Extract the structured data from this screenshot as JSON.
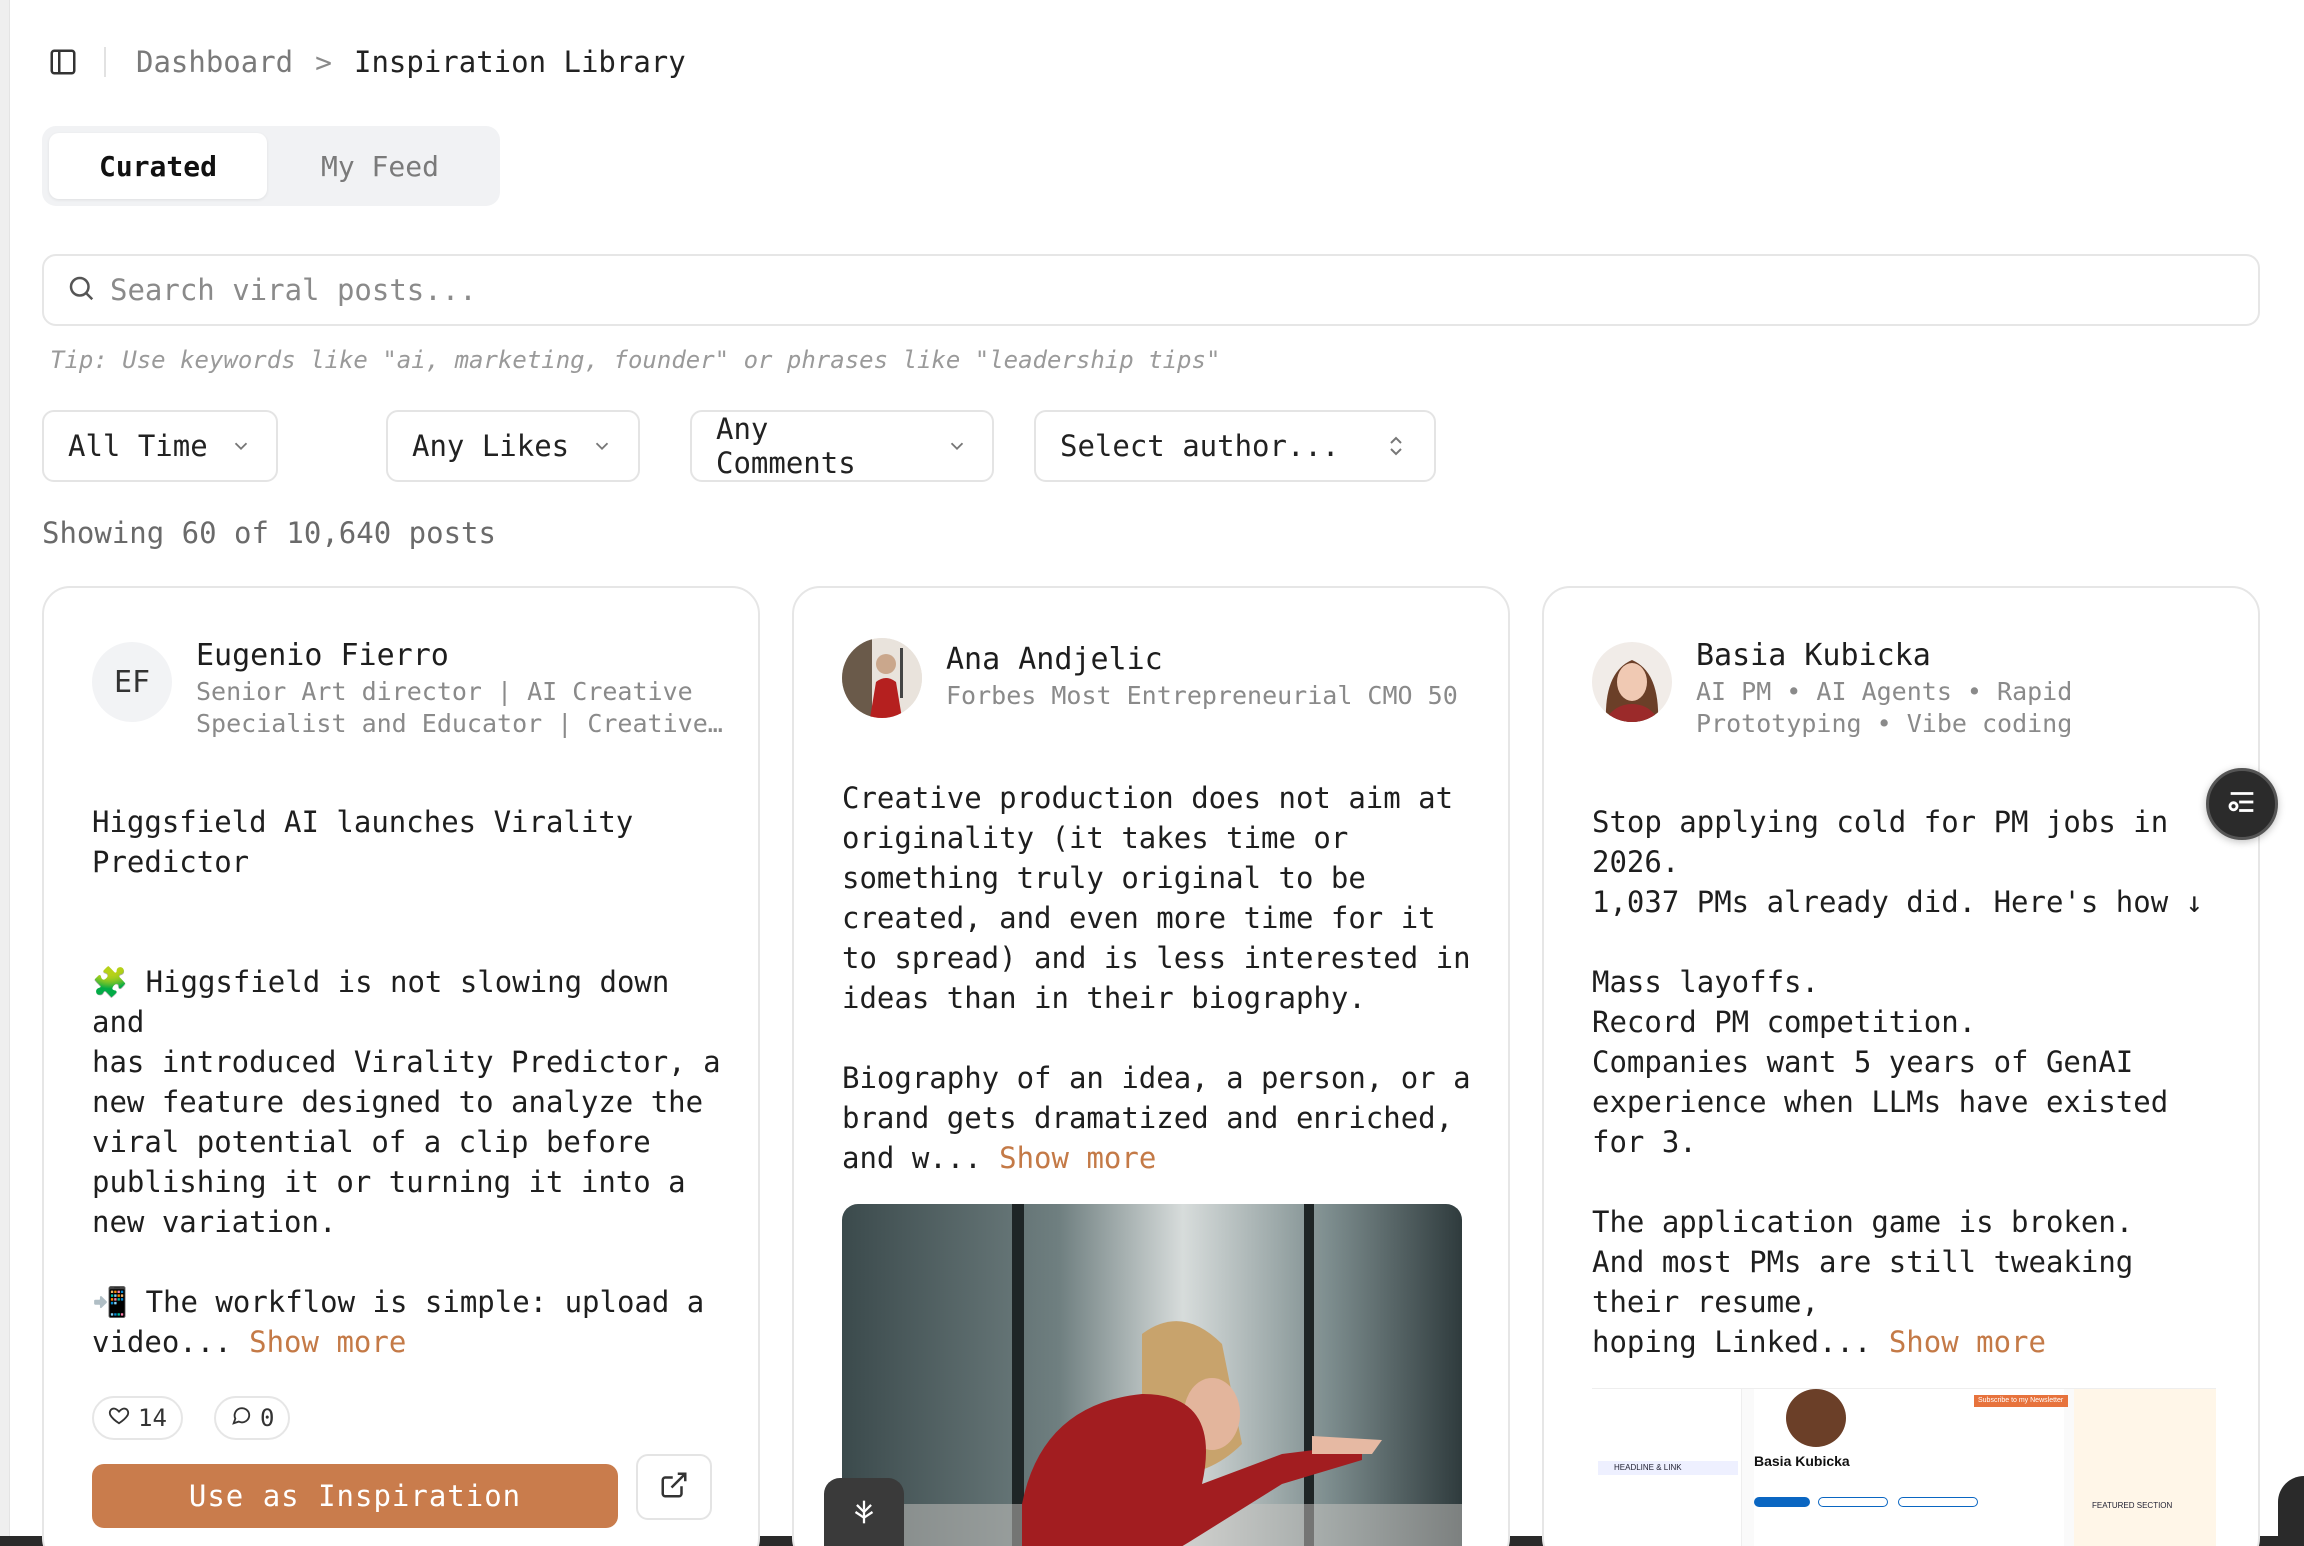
{
  "breadcrumb": {
    "parent": "Dashboard",
    "separator": ">",
    "current": "Inspiration Library"
  },
  "tabs": [
    {
      "label": "Curated",
      "active": true
    },
    {
      "label": "My Feed",
      "active": false
    }
  ],
  "search": {
    "placeholder": "Search viral posts...",
    "value": "",
    "tip": "Tip: Use keywords like \"ai, marketing, founder\" or phrases like \"leadership tips\""
  },
  "filters": {
    "time": "All Time",
    "likes": "Any Likes",
    "comments": "Any Comments",
    "author": "Select author..."
  },
  "results": {
    "summary": "Showing 60 of 10,640 posts"
  },
  "posts": [
    {
      "author": "Eugenio Fierro",
      "initials": "EF",
      "headline": "Senior Art director | AI Creative\nSpecialist and Educator | Creative…",
      "body": "Higgsfield AI launches Virality\nPredictor\n\n\n🧩 Higgsfield is not slowing down and\nhas introduced Virality Predictor, a\nnew feature designed to analyze the\nviral potential of a clip before\npublishing it or turning it into a\nnew variation.\n\n📲 The workflow is simple: upload a\nvideo... ",
      "show_more": "Show more",
      "likes": "14",
      "comments": "0",
      "cta": "Use as Inspiration"
    },
    {
      "author": "Ana Andjelic",
      "headline": "Forbes Most Entrepreneurial CMO 50",
      "body": "Creative production does not aim at\noriginality (it takes time or\nsomething truly original to be\ncreated, and even more time for it\nto spread) and is less interested in\nideas than in their biography.\n\nBiography of an idea, a person, or a\nbrand gets dramatized and enriched,\nand w... ",
      "show_more": "Show more"
    },
    {
      "author": "Basia Kubicka",
      "headline": "AI PM • AI Agents • Rapid\nPrototyping • Vibe coding",
      "body": "Stop applying cold for PM jobs in\n2026.\n1,037 PMs already did. Here's how ↓\n\nMass layoffs.\nRecord PM competition.\nCompanies want 5 years of GenAI\nexperience when LLMs have existed\nfor 3.\n\nThe application game is broken.\nAnd most PMs are still tweaking\ntheir resume,\nhoping Linked... ",
      "show_more": "Show more",
      "image": {
        "profile_name": "Basia Kubicka",
        "labels": [
          "HEADLINE & LINK",
          "FEATURED SECTION",
          "Subscribe to my Newsletter"
        ]
      }
    }
  ],
  "colors": {
    "accent": "#c97c4c",
    "border": "#e6e6e6",
    "muted": "#8a8a8a"
  }
}
